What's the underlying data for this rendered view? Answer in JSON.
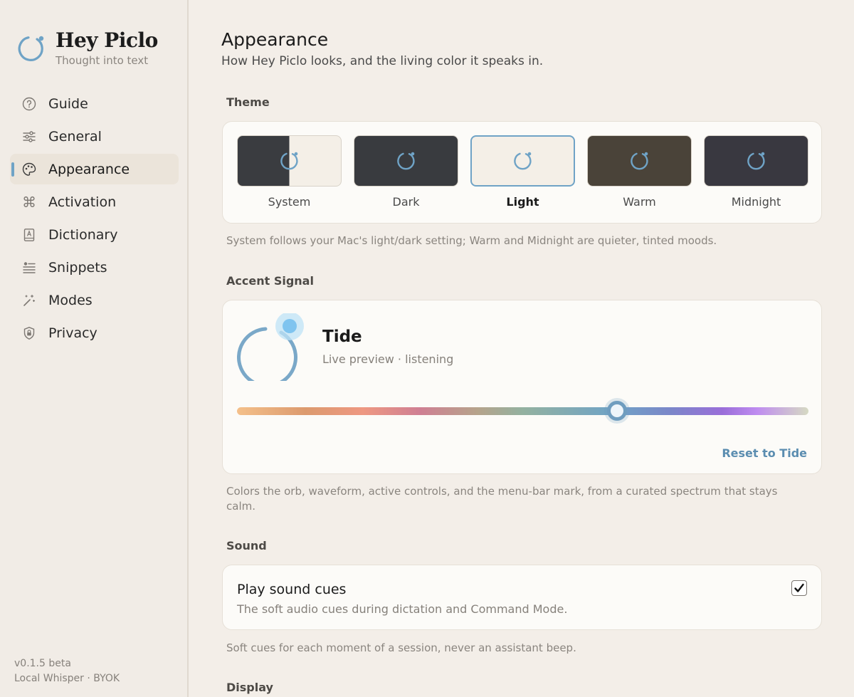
{
  "brand": {
    "title": "Hey Piclo",
    "subtitle": "Thought into text"
  },
  "sidebar": {
    "items": [
      {
        "label": "Guide",
        "icon": "question-circle-icon"
      },
      {
        "label": "General",
        "icon": "sliders-icon"
      },
      {
        "label": "Appearance",
        "icon": "palette-icon",
        "active": true
      },
      {
        "label": "Activation",
        "icon": "command-key-icon"
      },
      {
        "label": "Dictionary",
        "icon": "book-icon"
      },
      {
        "label": "Snippets",
        "icon": "snippets-list-icon"
      },
      {
        "label": "Modes",
        "icon": "magic-wand-icon"
      },
      {
        "label": "Privacy",
        "icon": "lock-shield-icon"
      }
    ],
    "version": "v0.1.5 beta",
    "engine": "Local Whisper · BYOK"
  },
  "page": {
    "title": "Appearance",
    "subtitle": "How Hey Piclo looks, and the living color it speaks in."
  },
  "theme": {
    "label": "Theme",
    "options": [
      "System",
      "Dark",
      "Light",
      "Warm",
      "Midnight"
    ],
    "selected": "Light",
    "help": "System follows your Mac's light/dark setting; Warm and Midnight are quieter, tinted moods."
  },
  "accent": {
    "label": "Accent Signal",
    "name": "Tide",
    "preview": "Live preview · listening",
    "slider_value_percent": 66.5,
    "reset_label": "Reset to Tide",
    "help": "Colors the orb, waveform, active controls, and the menu-bar mark, from a curated spectrum that stays calm.",
    "color": "#6fa3c6"
  },
  "sound": {
    "label": "Sound",
    "title": "Play sound cues",
    "subtitle": "The soft audio cues during dictation and Command Mode.",
    "checked": true,
    "help": "Soft cues for each moment of a session, never an assistant beep."
  },
  "display": {
    "label": "Display"
  }
}
